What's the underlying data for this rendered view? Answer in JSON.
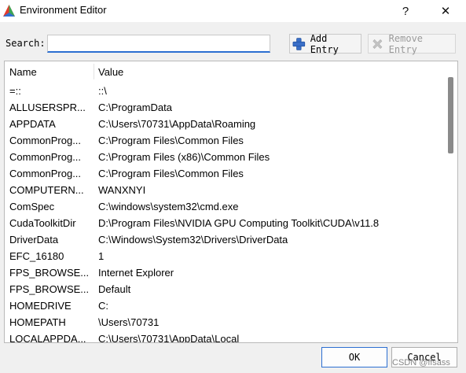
{
  "window": {
    "title": "Environment Editor",
    "help_label": "?",
    "close_label": "✕"
  },
  "search": {
    "label": "Search:",
    "value": ""
  },
  "toolbar": {
    "add_label": "Add Entry",
    "remove_label": "Remove Entry"
  },
  "table": {
    "columns": [
      "Name",
      "Value"
    ],
    "rows": [
      {
        "name": "=::",
        "value": "::\\"
      },
      {
        "name": "ALLUSERSPR...",
        "value": "C:\\ProgramData"
      },
      {
        "name": "APPDATA",
        "value": "C:\\Users\\70731\\AppData\\Roaming"
      },
      {
        "name": "CommonProg...",
        "value": "C:\\Program Files\\Common Files"
      },
      {
        "name": "CommonProg...",
        "value": "C:\\Program Files (x86)\\Common Files"
      },
      {
        "name": "CommonProg...",
        "value": "C:\\Program Files\\Common Files"
      },
      {
        "name": "COMPUTERN...",
        "value": "WANXNYI"
      },
      {
        "name": "ComSpec",
        "value": "C:\\windows\\system32\\cmd.exe"
      },
      {
        "name": "CudaToolkitDir",
        "value": "D:\\Program Files\\NVIDIA GPU Computing Toolkit\\CUDA\\v11.8"
      },
      {
        "name": "DriverData",
        "value": "C:\\Windows\\System32\\Drivers\\DriverData"
      },
      {
        "name": "EFC_16180",
        "value": "1"
      },
      {
        "name": "FPS_BROWSE...",
        "value": "Internet Explorer"
      },
      {
        "name": "FPS_BROWSE...",
        "value": "Default"
      },
      {
        "name": "HOMEDRIVE",
        "value": "C:"
      },
      {
        "name": "HOMEPATH",
        "value": "\\Users\\70731"
      },
      {
        "name": "LOCALAPPDA...",
        "value": "C:\\Users\\70731\\AppData\\Local"
      }
    ]
  },
  "buttons": {
    "ok_label": "OK",
    "cancel_label": "Cancel"
  },
  "watermark": "CSDN @ffsass",
  "colors": {
    "accent": "#2c6fd1",
    "add_icon": "#3a6fc8",
    "disabled": "#9a9a9a"
  },
  "icons": {
    "app": "triangle-logo-icon",
    "add": "plus-icon",
    "remove": "x-icon"
  }
}
